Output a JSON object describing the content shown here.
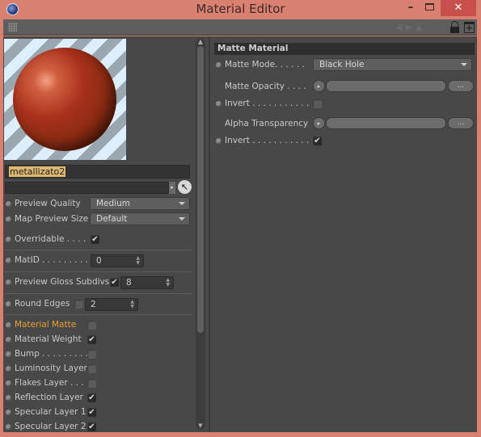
{
  "window": {
    "title": "Material Editor",
    "minimize_glyph": "–",
    "close_glyph": "✕"
  },
  "toolbar": {
    "nav_glyphs": "◀▶▲",
    "new_window_glyph": "+"
  },
  "preview": {
    "material_name": "metallizato2",
    "picker_glyph": "↖",
    "link_arrow_glyph": "▸"
  },
  "settings": {
    "preview_quality": {
      "label": "Preview Quality",
      "value": "Medium"
    },
    "map_preview_size": {
      "label": "Map Preview Size",
      "value": "Default"
    },
    "overridable": {
      "label": "Overridable . . . .",
      "checked": true
    },
    "matid": {
      "label": "MatID . . . . . . . . .",
      "value": "0"
    },
    "preview_gloss_subdivs": {
      "label": "Preview Gloss Subdivs",
      "checked": true,
      "value": "8"
    },
    "round_edges": {
      "label": "Round Edges",
      "checked": false,
      "value": "2"
    }
  },
  "layers": [
    {
      "label": "Material Matte",
      "checked": false,
      "active": true
    },
    {
      "label": "Material Weight",
      "checked": true,
      "active": false
    },
    {
      "label": "Bump . . . . . . . . .",
      "checked": false,
      "active": false
    },
    {
      "label": "Luminosity Layer",
      "checked": false,
      "active": false
    },
    {
      "label": "Flakes Layer . . . .",
      "checked": false,
      "active": false
    },
    {
      "label": "Reflection Layer",
      "checked": true,
      "active": false
    },
    {
      "label": "Specular Layer 1",
      "checked": true,
      "active": false
    },
    {
      "label": "Specular Layer 2",
      "checked": true,
      "active": false
    }
  ],
  "matte_material": {
    "section_title": "Matte Material",
    "matte_mode": {
      "label": "Matte Mode. . . . . .",
      "value": "Black Hole"
    },
    "matte_opacity": {
      "label": "Matte Opacity . . . .",
      "dots_label": "..."
    },
    "invert1": {
      "label": "Invert . . . . . . . . . . .",
      "checked": false
    },
    "alpha_transparency": {
      "label": "Alpha Transparency",
      "dots_label": "..."
    },
    "invert2": {
      "label": "Invert . . . . . . . . . . .",
      "checked": true
    }
  },
  "glyphs": {
    "check": "✔",
    "spin": "▲▼",
    "up": "▲",
    "down": "▼",
    "play": "▸"
  },
  "colors": {
    "titlebar": "#d98070",
    "panel": "#484848",
    "highlight": "#e8a030",
    "close": "#c7504a"
  }
}
